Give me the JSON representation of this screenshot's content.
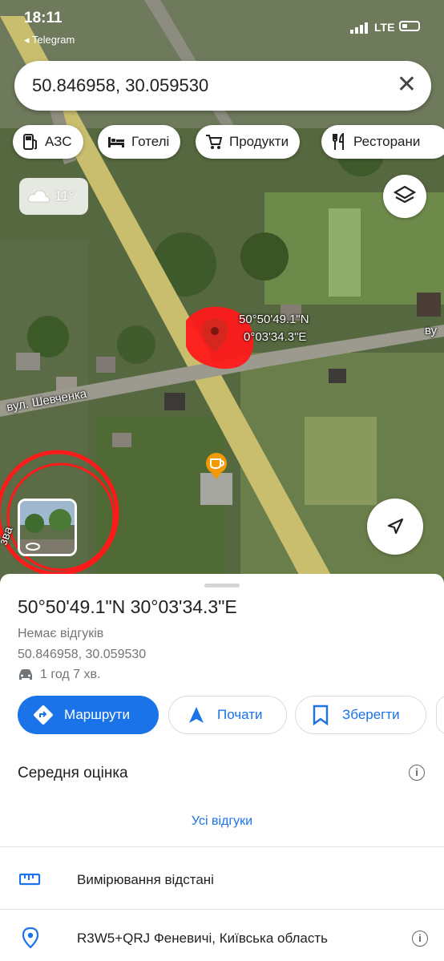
{
  "status_bar": {
    "time": "18:11",
    "back_label": "◂ Telegram",
    "network": "LTE"
  },
  "search": {
    "query": "50.846958, 30.059530"
  },
  "chips": [
    {
      "label": "АЗС",
      "icon": "gas-station-icon"
    },
    {
      "label": "Готелі",
      "icon": "bed-icon"
    },
    {
      "label": "Продукти",
      "icon": "cart-icon"
    },
    {
      "label": "Ресторани",
      "icon": "fork-knife-icon"
    }
  ],
  "weather": {
    "temp": "11°"
  },
  "map": {
    "pin_label_lat": "50°50'49.1\"N",
    "pin_label_lon": "0°03'34.3\"E",
    "street_label": "вул. Шевченка",
    "edge_label_right": "ву",
    "edge_label_left": "зва",
    "colors": {
      "road": "#d4c36a",
      "pin": "#ea4335",
      "annotation": "#ff1a1a"
    }
  },
  "sheet": {
    "title": "50°50'49.1\"N 30°03'34.3\"E",
    "reviews": "Немає відгуків",
    "coords": "50.846958, 30.059530",
    "drive_time": "1 год 7 хв.",
    "actions": {
      "directions": "Маршрути",
      "start": "Почати",
      "save": "Зберегти"
    },
    "rating_title": "Середня оцінка",
    "all_reviews": "Усі відгуки",
    "measure": "Вимірювання відстані",
    "plus_code": "R3W5+QRJ Феневичі, Київська область"
  }
}
